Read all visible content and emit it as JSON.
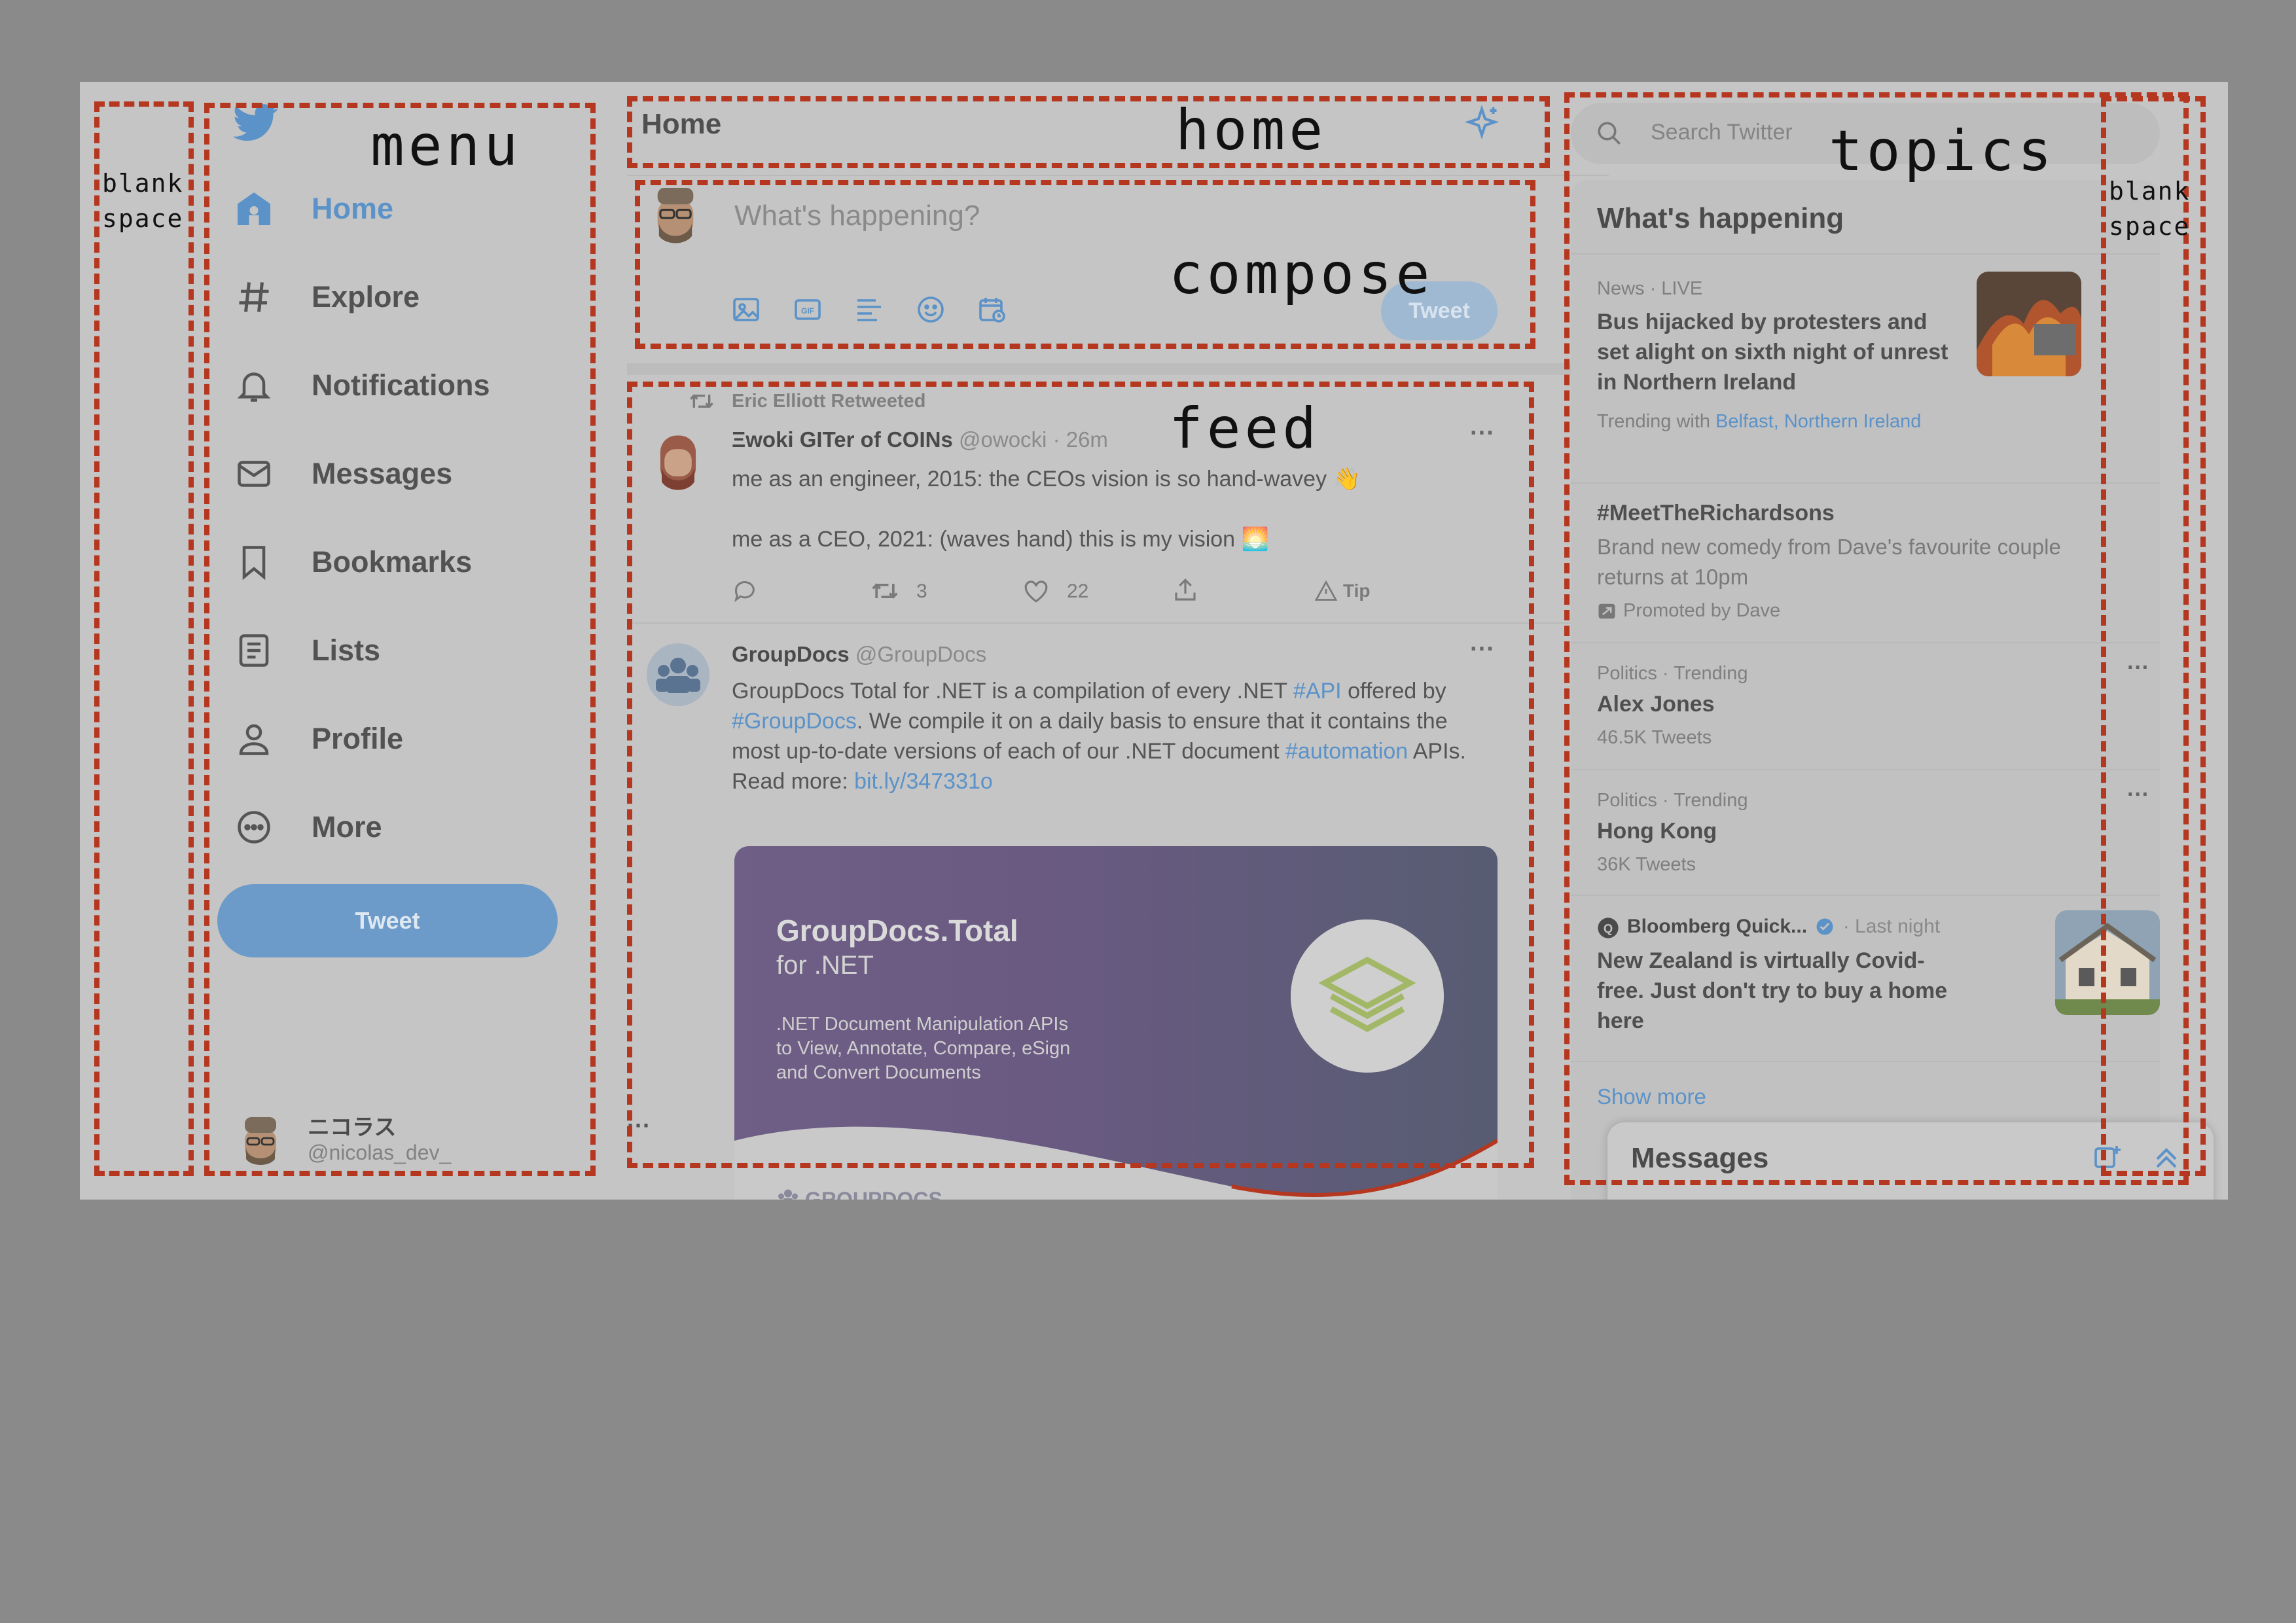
{
  "menu": {
    "items": [
      {
        "label": "Home",
        "icon": "home-icon",
        "active": true
      },
      {
        "label": "Explore",
        "icon": "hashtag-icon"
      },
      {
        "label": "Notifications",
        "icon": "bell-icon"
      },
      {
        "label": "Messages",
        "icon": "envelope-icon"
      },
      {
        "label": "Bookmarks",
        "icon": "bookmark-icon"
      },
      {
        "label": "Lists",
        "icon": "list-icon"
      },
      {
        "label": "Profile",
        "icon": "person-icon"
      },
      {
        "label": "More",
        "icon": "more-circle-icon"
      }
    ],
    "tweet_button": "Tweet",
    "account": {
      "name": "ニコラス",
      "handle": "@nicolas_dev_",
      "more": "···"
    }
  },
  "header": {
    "title": "Home"
  },
  "compose": {
    "placeholder": "What's happening?",
    "tweet_button": "Tweet"
  },
  "feed": {
    "tweet1": {
      "retweeted_by": "Eric Elliott Retweeted",
      "name": "Ξwoki GITer of COINs",
      "handle": "@owocki",
      "time": "· 26m",
      "line1": "me as an engineer, 2015: the CEOs vision is so hand-wavey 👋",
      "line2": "me as a CEO, 2021: (waves hand) this is my vision 🌅",
      "retweets": "3",
      "likes": "22",
      "tip": "Tip",
      "more": "···"
    },
    "tweet2": {
      "name": "GroupDocs",
      "handle": "@GroupDocs",
      "text_a": "GroupDocs Total for .NET is a compilation of every .NET ",
      "tag_api": "#API",
      "text_b": " offered by",
      "tag_groupdocs": "#GroupDocs",
      "text_c": ". We compile it on a daily basis to ensure that it contains the most up-to-date versions of each of our .NET document ",
      "tag_automation": "#automation",
      "text_d": " APIs.",
      "read_more": "Read more: ",
      "link": "bit.ly/347331o",
      "more": "···",
      "card": {
        "title": "GroupDocs.Total",
        "subtitle": "for .NET",
        "desc1": ".NET Document Manipulation APIs",
        "desc2": "to View, Annotate, Compare, eSign",
        "desc3": "and Convert Documents",
        "brand": "GROUPDOCS"
      }
    }
  },
  "topics": {
    "search_placeholder": "Search Twitter",
    "heading": "What's happening",
    "t1": {
      "meta": "News · LIVE",
      "title": "Bus hijacked by protesters and set alight on sixth night of unrest in Northern Ireland",
      "trending_with": "Trending with ",
      "tags": "Belfast, Northern Ireland"
    },
    "t2": {
      "title": "#MeetTheRichardsons",
      "desc": "Brand new comedy from Dave's favourite couple returns at 10pm",
      "promoted": "Promoted by Dave"
    },
    "t3": {
      "meta": "Politics · Trending",
      "title": "Alex Jones",
      "count": "46.5K Tweets",
      "more": "···"
    },
    "t4": {
      "meta": "Politics · Trending",
      "title": "Hong Kong",
      "count": "36K Tweets",
      "more": "···"
    },
    "t5": {
      "source": "Bloomberg Quick...",
      "time": "· Last night",
      "title": "New Zealand is virtually Covid-free. Just don't try to buy a home here"
    },
    "show_more": "Show more",
    "messages": "Messages"
  },
  "annotations": {
    "blank_left": "blank\nspace",
    "menu": "menu",
    "home": "home",
    "compose": "compose",
    "feed": "feed",
    "topics": "topics",
    "blank_right": "blank\nspace"
  }
}
